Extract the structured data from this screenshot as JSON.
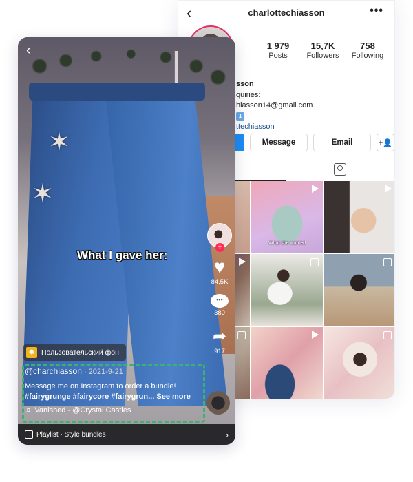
{
  "instagram": {
    "header": {
      "back_icon": "‹",
      "username": "charlottechiasson",
      "more_icon": "•••"
    },
    "stats": [
      {
        "value": "1 979",
        "label": "Posts"
      },
      {
        "value": "15,7K",
        "label": "Followers"
      },
      {
        "value": "758",
        "label": "Following"
      }
    ],
    "bio": {
      "name_fragment": "sson",
      "line2": "quiries:",
      "email_fragment": "hiasson14@gmail.com",
      "emoji": "⬇",
      "link_fragment": "ttechiasson"
    },
    "buttons": {
      "message": "Message",
      "email": "Email",
      "add_user_icon": "+👤"
    },
    "grid": [
      {
        "type": "image"
      },
      {
        "type": "video",
        "caption": "What she wanted"
      },
      {
        "type": "video"
      },
      {
        "type": "video"
      },
      {
        "type": "carousel"
      },
      {
        "type": "carousel"
      },
      {
        "type": "carousel"
      },
      {
        "type": "video"
      },
      {
        "type": "carousel"
      }
    ]
  },
  "tiktok": {
    "back_icon": "‹",
    "overlay_text": "What I gave her:",
    "likes": "84,5K",
    "comments": "380",
    "shares": "917",
    "comment_icon": "•••",
    "background_tag": "Пользовательский фон",
    "author": "@charchiasson",
    "date": " · 2021-9-21",
    "caption": "Message me on Instagram to order a bundle!",
    "hashtags": "#fairygrunge #fairycore #fairygrun...",
    "see_more": "See more",
    "music_icon": "♫",
    "music": "Vanished - @Crystal Castles",
    "playlist": "Playlist · Style bundles",
    "chevron": "›",
    "highlight_color": "#3bb273"
  }
}
